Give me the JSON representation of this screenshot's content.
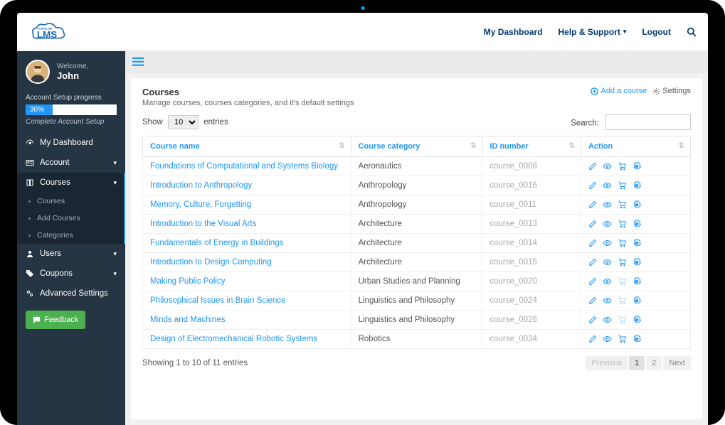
{
  "topnav": {
    "dashboard": "My Dashboard",
    "help": "Help & Support",
    "logout": "Logout"
  },
  "sidebar": {
    "welcome": "Welcome,",
    "username": "John",
    "setup_label": "Account Setup progress",
    "setup_percent": "30%",
    "complete": "Complete Account Setup",
    "items": [
      {
        "label": "My Dashboard",
        "icon": "speedometer"
      },
      {
        "label": "Account",
        "icon": "id-card",
        "expand": true
      },
      {
        "label": "Courses",
        "icon": "book",
        "expand": true,
        "active": true
      },
      {
        "label": "Users",
        "icon": "user",
        "expand": true
      },
      {
        "label": "Coupons",
        "icon": "tag",
        "expand": true
      },
      {
        "label": "Advanced Settings",
        "icon": "cogs"
      }
    ],
    "courses_sub": [
      "Courses",
      "Add Courses",
      "Categories"
    ],
    "feedback": "Feedback"
  },
  "panel": {
    "title": "Courses",
    "subtitle": "Manage courses, courses categories, and it's default settings",
    "add_link": "Add a course",
    "settings_link": "Settings",
    "show_prefix": "Show",
    "show_value": "10",
    "show_suffix": "entries",
    "search_label": "Search:",
    "headers": [
      "Course name",
      "Course category",
      "ID number",
      "Action"
    ],
    "rows": [
      {
        "name": "Foundations of Computational and Systems Biology",
        "cat": "Aeronautics",
        "id": "course_0008",
        "cart_dim": false
      },
      {
        "name": "Introduction to Anthropology",
        "cat": "Anthropology",
        "id": "course_0016",
        "cart_dim": false
      },
      {
        "name": "Memory, Culture, Forgetting",
        "cat": "Anthropology",
        "id": "course_0011",
        "cart_dim": false
      },
      {
        "name": "Introduction to the Visual Arts",
        "cat": "Architecture",
        "id": "course_0013",
        "cart_dim": false
      },
      {
        "name": "Fundamentals of Energy in Buildings",
        "cat": "Architecture",
        "id": "course_0014",
        "cart_dim": false
      },
      {
        "name": "Introduction to Design Computing",
        "cat": "Architecture",
        "id": "course_0015",
        "cart_dim": false
      },
      {
        "name": "Making Public Policy",
        "cat": "Urban Studies and Planning",
        "id": "course_0020",
        "cart_dim": true
      },
      {
        "name": "Philosophical Issues in Brain Science",
        "cat": "Linguistics and Philosophy",
        "id": "course_0024",
        "cart_dim": true
      },
      {
        "name": "Minds and Machines",
        "cat": "Linguistics and Philosophy",
        "id": "course_0026",
        "cart_dim": true
      },
      {
        "name": "Design of Electromechanical Robotic Systems",
        "cat": "Robotics",
        "id": "course_0034",
        "cart_dim": false
      }
    ],
    "foot_info": "Showing 1 to 10 of 11 entries",
    "pagination": {
      "prev": "Previous",
      "pages": [
        "1",
        "2"
      ],
      "next": "Next",
      "active": 0
    }
  }
}
